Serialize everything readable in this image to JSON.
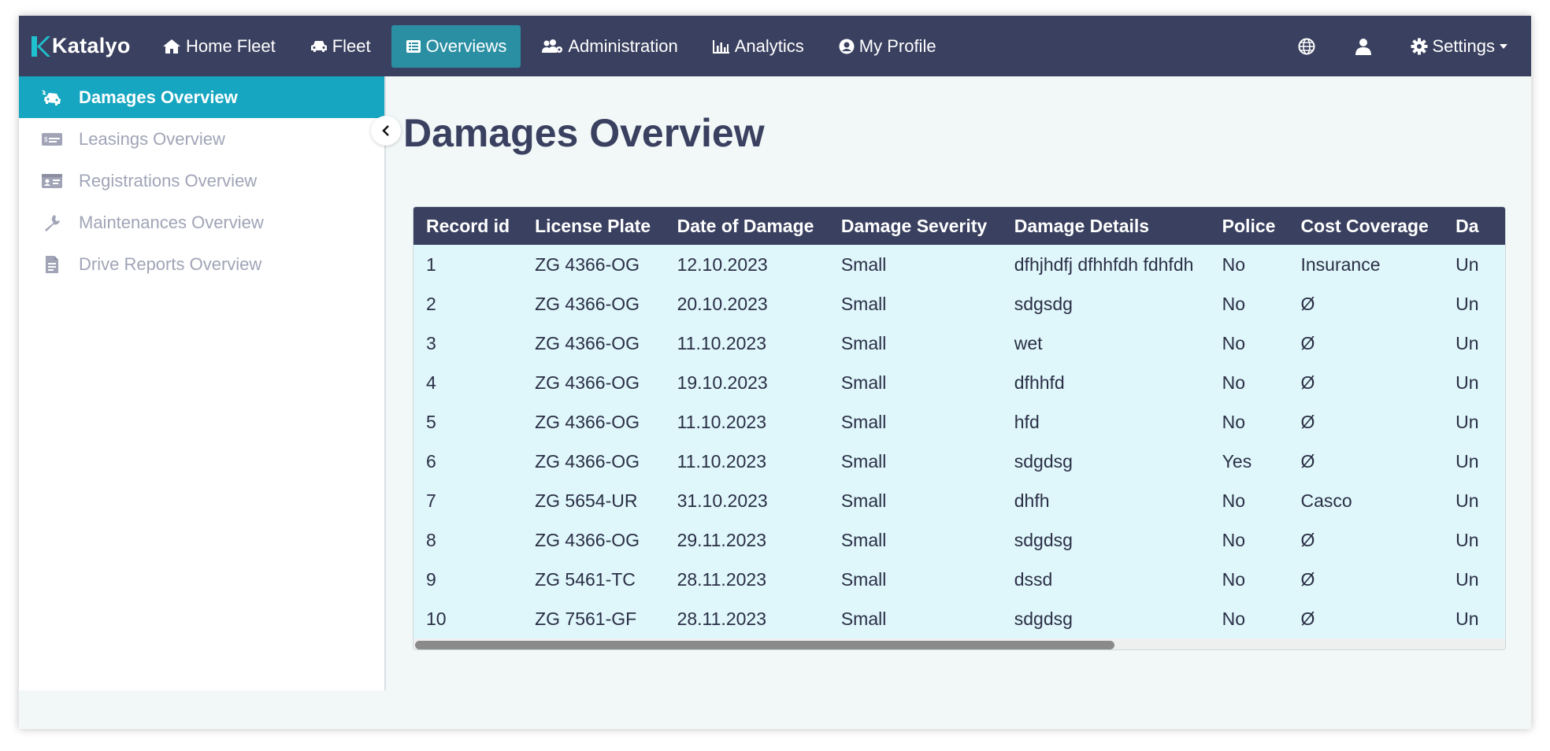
{
  "app": {
    "logo_text": "Katalyo"
  },
  "nav": {
    "items": [
      {
        "label": "Home Fleet",
        "icon": "home-icon",
        "active": false
      },
      {
        "label": "Fleet",
        "icon": "car-icon",
        "active": false
      },
      {
        "label": "Overviews",
        "icon": "list-icon",
        "active": true
      },
      {
        "label": "Administration",
        "icon": "users-cog-icon",
        "active": false
      },
      {
        "label": "Analytics",
        "icon": "bar-chart-icon",
        "active": false
      },
      {
        "label": "My Profile",
        "icon": "user-circle-icon",
        "active": false
      }
    ],
    "settings_label": "Settings"
  },
  "sidebar": {
    "items": [
      {
        "label": "Damages Overview",
        "icon": "car-crash-icon",
        "active": true
      },
      {
        "label": "Leasings Overview",
        "icon": "money-card-icon",
        "active": false
      },
      {
        "label": "Registrations Overview",
        "icon": "id-card-icon",
        "active": false
      },
      {
        "label": "Maintenances Overview",
        "icon": "wrench-icon",
        "active": false
      },
      {
        "label": "Drive Reports Overview",
        "icon": "document-icon",
        "active": false
      }
    ]
  },
  "main": {
    "title": "Damages Overview",
    "table": {
      "columns": [
        "Record id",
        "License Plate",
        "Date of Damage",
        "Damage Severity",
        "Damage Details",
        "Police",
        "Cost Coverage",
        "Da"
      ],
      "rows": [
        [
          "1",
          "ZG 4366-OG",
          "12.10.2023",
          "Small",
          "dfhjhdfj dfhhfdh fdhfdh",
          "No",
          "Insurance",
          "Un"
        ],
        [
          "2",
          "ZG 4366-OG",
          "20.10.2023",
          "Small",
          "sdgsdg",
          "No",
          "Ø",
          "Un"
        ],
        [
          "3",
          "ZG 4366-OG",
          "11.10.2023",
          "Small",
          "wet",
          "No",
          "Ø",
          "Un"
        ],
        [
          "4",
          "ZG 4366-OG",
          "19.10.2023",
          "Small",
          "dfhhfd",
          "No",
          "Ø",
          "Un"
        ],
        [
          "5",
          "ZG 4366-OG",
          "11.10.2023",
          "Small",
          "hfd",
          "No",
          "Ø",
          "Un"
        ],
        [
          "6",
          "ZG 4366-OG",
          "11.10.2023",
          "Small",
          "sdgdsg",
          "Yes",
          "Ø",
          "Un"
        ],
        [
          "7",
          "ZG 5654-UR",
          "31.10.2023",
          "Small",
          "dhfh",
          "No",
          "Casco",
          "Un"
        ],
        [
          "8",
          "ZG 4366-OG",
          "29.11.2023",
          "Small",
          "sdgdsg",
          "No",
          "Ø",
          "Un"
        ],
        [
          "9",
          "ZG 5461-TC",
          "28.11.2023",
          "Small",
          "dssd",
          "No",
          "Ø",
          "Un"
        ],
        [
          "10",
          "ZG 7561-GF",
          "28.11.2023",
          "Small",
          "sdgdsg",
          "No",
          "Ø",
          "Un"
        ]
      ]
    }
  },
  "colors": {
    "topbar": "#3a405f",
    "nav_active": "#2a8fa3",
    "sidebar_active": "#17a6c1",
    "table_body": "#dff6fb"
  }
}
